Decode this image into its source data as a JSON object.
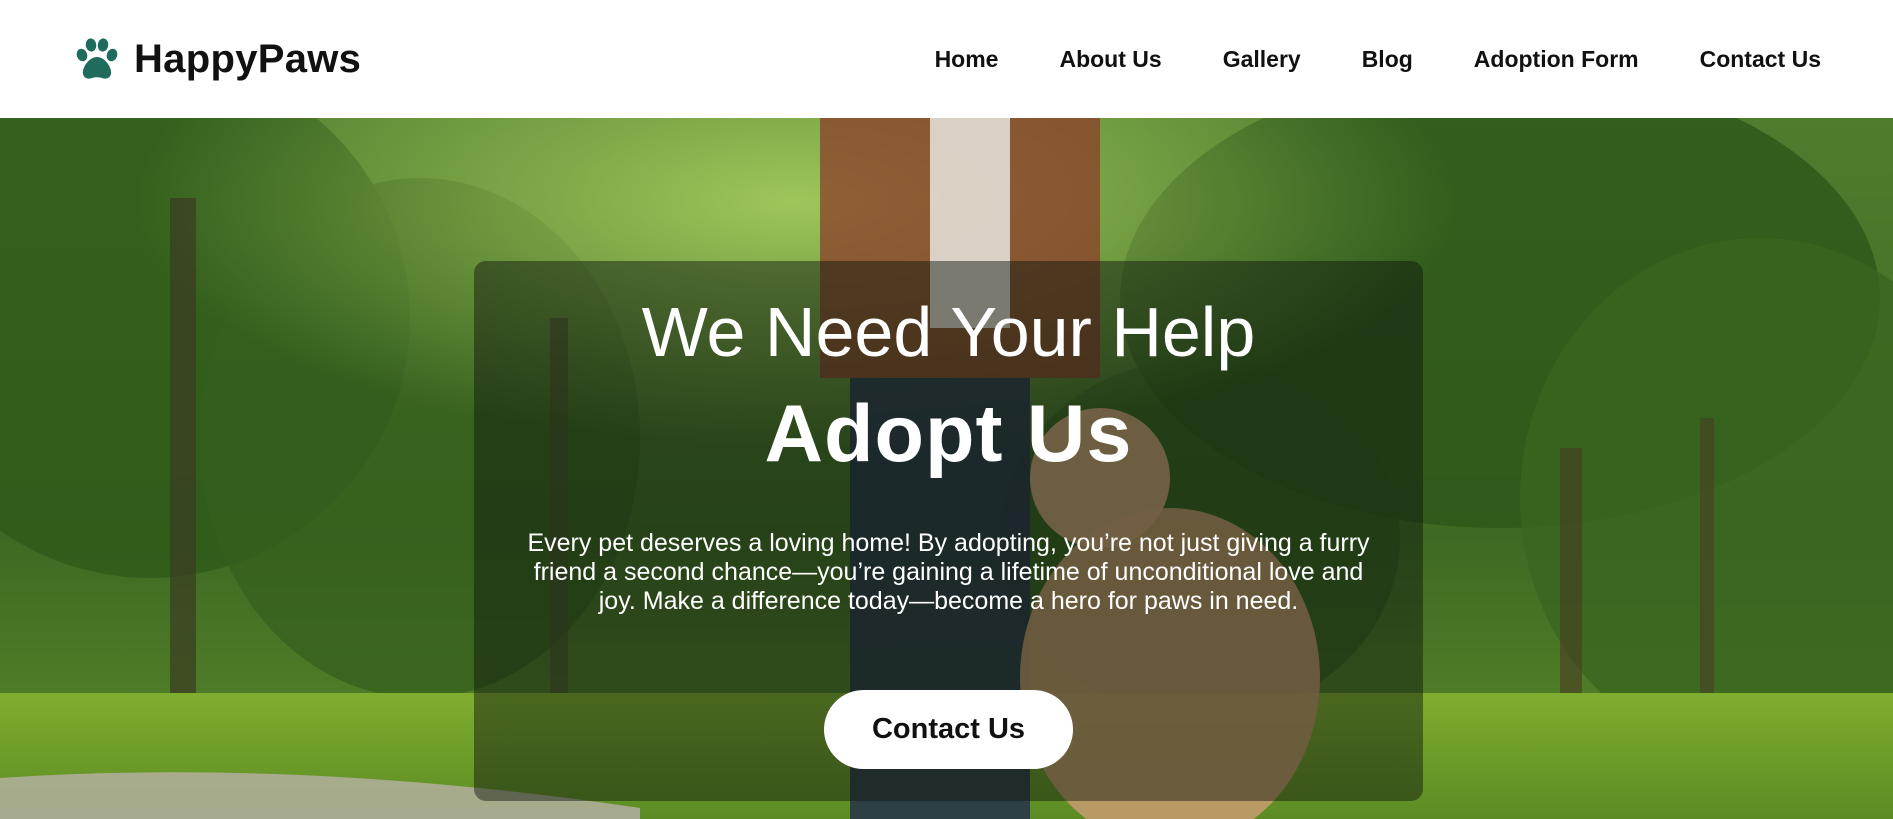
{
  "brand": {
    "name": "HappyPaws",
    "icon": "paw-icon",
    "icon_color": "#1f6b5c"
  },
  "nav": {
    "items": [
      {
        "label": "Home"
      },
      {
        "label": "About Us"
      },
      {
        "label": "Gallery"
      },
      {
        "label": "Blog"
      },
      {
        "label": "Adoption Form"
      },
      {
        "label": "Contact Us"
      }
    ]
  },
  "hero": {
    "kicker": "We Need Your Help",
    "headline": "Adopt Us",
    "description": "Every pet deserves a loving home! By adopting, you’re not just giving a furry friend a second chance—you’re gaining a lifetime of unconditional love and joy. Make a difference today—become a hero for paws in need.",
    "cta_label": "Contact Us"
  },
  "colors": {
    "header_bg": "#ffffff",
    "text_dark": "#111111",
    "hero_text": "#ffffff",
    "overlay": "rgba(14,20,12,0.46)",
    "button_bg": "#ffffff"
  }
}
